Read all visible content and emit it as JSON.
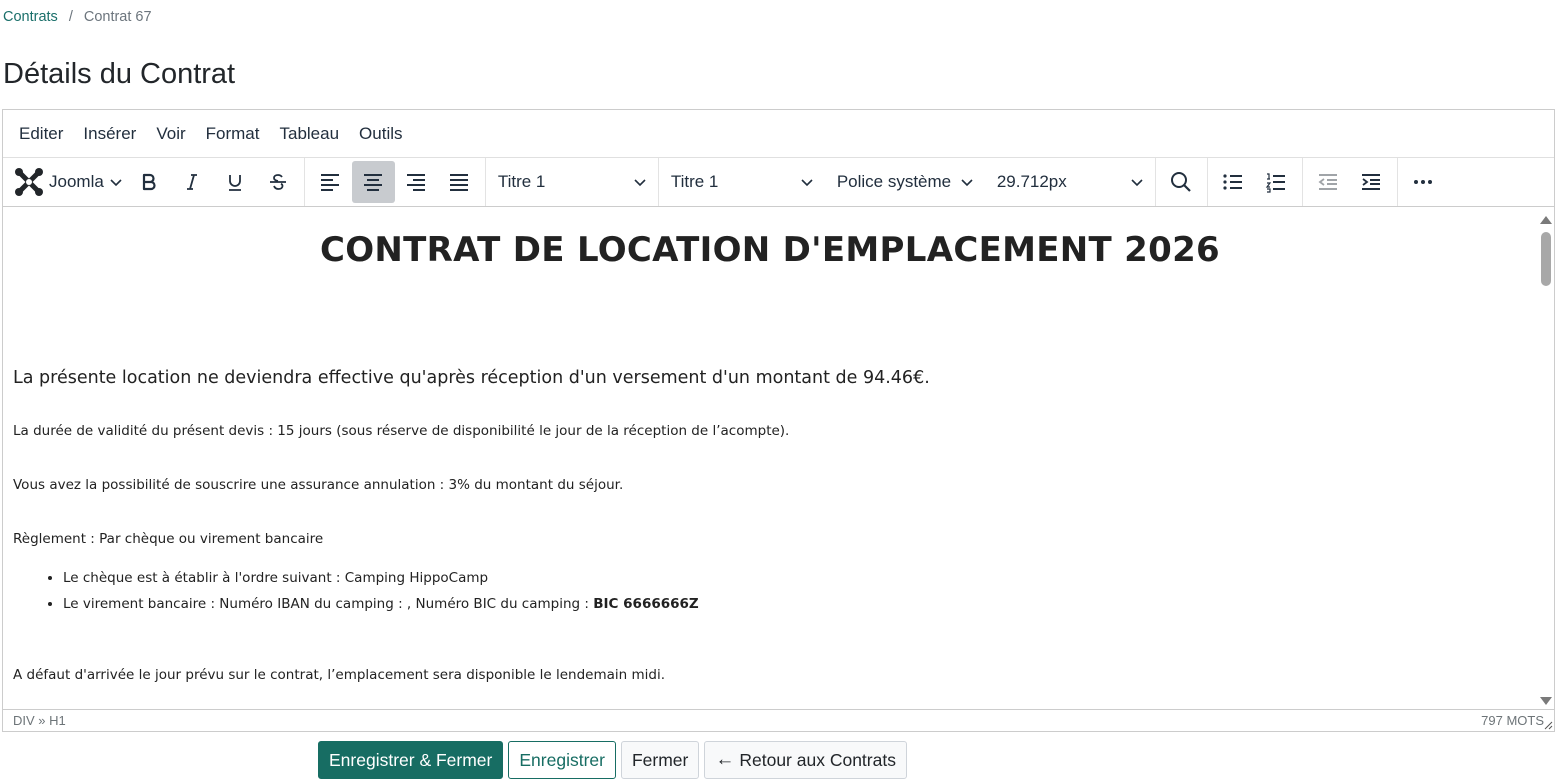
{
  "breadcrumb": {
    "parent": "Contrats",
    "separator": "/",
    "current": "Contrat 67"
  },
  "page_title": "Détails du Contrat",
  "editor": {
    "menu": [
      "Editer",
      "Insérer",
      "Voir",
      "Format",
      "Tableau",
      "Outils"
    ],
    "toolbar": {
      "joomla_label": "Joomla",
      "block_format": "Titre 1",
      "styles": "Titre 1",
      "font_family": "Police système",
      "font_size": "29.712px",
      "active_alignment": "center"
    },
    "content": {
      "heading": "CONTRAT DE LOCATION D'EMPLACEMENT 2026",
      "lead": "La présente location ne deviendra effective qu'après réception d'un versement d'un montant de 94.46€.",
      "validity": "La durée de validité du présent devis : 15 jours (sous réserve de disponibilité le jour de la réception de l’acompte).",
      "insurance": "Vous avez la possibilité de souscrire une assurance annulation : 3% du montant du séjour.",
      "payment": "Règlement : Par chèque ou virement bancaire",
      "list": {
        "cheque": "Le chèque est à établir à l'ordre suivant : Camping HippoCamp",
        "transfer_prefix": "Le virement bancaire : Numéro IBAN du camping :  ,  Numéro BIC du camping : ",
        "transfer_bic": "BIC 6666666Z"
      },
      "arrival": "A défaut d'arrivée le jour prévu sur le contrat, l’emplacement sera disponible le lendemain midi."
    },
    "status": {
      "path": "DIV » H1",
      "word_count": "797 MOTS"
    }
  },
  "actions": {
    "save_close": "Enregistrer & Fermer",
    "save": "Enregistrer",
    "close": "Fermer",
    "back": "Retour aux Contrats",
    "back_arrow": "←"
  },
  "colors": {
    "primary": "#176d63",
    "link": "#1a6f6a",
    "active_tool": "#c8cbcf"
  }
}
